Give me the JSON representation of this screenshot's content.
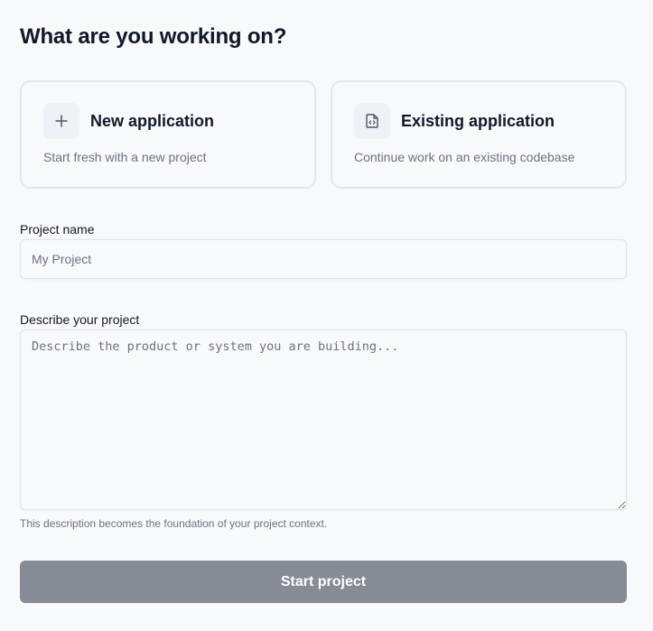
{
  "page": {
    "title": "What are you working on?"
  },
  "options": [
    {
      "title": "New application",
      "description": "Start fresh with a new project",
      "icon": "plus-icon"
    },
    {
      "title": "Existing application",
      "description": "Continue work on an existing codebase",
      "icon": "code-file-icon"
    }
  ],
  "form": {
    "project_name": {
      "label": "Project name",
      "value": "",
      "placeholder": "My Project"
    },
    "description": {
      "label": "Describe your project",
      "value": "",
      "placeholder": "Describe the product or system you are building...",
      "helper": "This description becomes the foundation of your project context."
    },
    "submit_label": "Start project"
  },
  "colors": {
    "background": "#f8f9fb",
    "card_border": "#e3e6ec",
    "icon_bg": "#eef1f6",
    "muted_text": "#6b7280",
    "button_disabled": "#878b95"
  }
}
